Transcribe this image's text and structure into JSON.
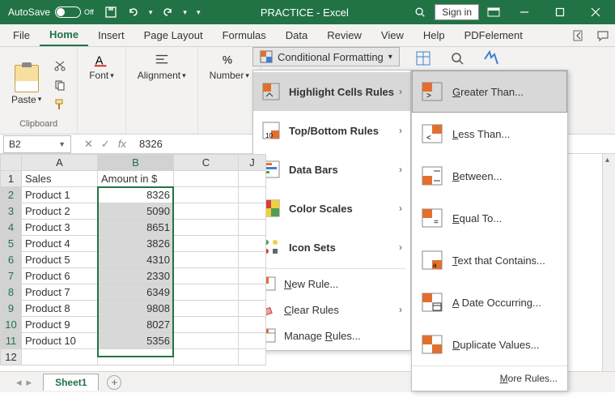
{
  "title_bar": {
    "autosave": "AutoSave",
    "autosave_state": "Off",
    "doc_title": "PRACTICE  -  Excel",
    "signin": "Sign in"
  },
  "tabs": {
    "items": [
      "File",
      "Home",
      "Insert",
      "Page Layout",
      "Formulas",
      "Data",
      "Review",
      "View",
      "Help",
      "PDFelement"
    ],
    "active_index": 1
  },
  "ribbon": {
    "clipboard_label": "Clipboard",
    "paste": "Paste",
    "font": "Font",
    "alignment": "Alignment",
    "number": "Number",
    "cf_button": "Conditional Formatting",
    "menu": {
      "highlight": "Highlight Cells Rules",
      "topbottom": "Top/Bottom Rules",
      "databars": "Data Bars",
      "colorscales": "Color Scales",
      "iconsets": "Icon Sets",
      "newrule": "New Rule...",
      "clearrules": "Clear Rules",
      "managerules": "Manage Rules..."
    },
    "submenu": {
      "greater": "Greater Than...",
      "less": "Less Than...",
      "between": "Between...",
      "equal": "Equal To...",
      "textcontains": "Text that Contains...",
      "dateoccur": "A Date Occurring...",
      "duplicate": "Duplicate Values...",
      "more": "More Rules..."
    }
  },
  "formula_bar": {
    "name": "B2",
    "value": "8326"
  },
  "grid": {
    "headers": [
      "A",
      "B",
      "C",
      "J"
    ],
    "row_labels": [
      "1",
      "2",
      "3",
      "4",
      "5",
      "6",
      "7",
      "8",
      "9",
      "10",
      "11",
      "12"
    ],
    "a_header": "Sales",
    "b_header": "Amount in $",
    "rows": [
      {
        "a": "Product 1",
        "b": "8326"
      },
      {
        "a": "Product 2",
        "b": "5090"
      },
      {
        "a": "Product 3",
        "b": "8651"
      },
      {
        "a": "Product 4",
        "b": "3826"
      },
      {
        "a": "Product 5",
        "b": "4310"
      },
      {
        "a": "Product 6",
        "b": "2330"
      },
      {
        "a": "Product 7",
        "b": "6349"
      },
      {
        "a": "Product 8",
        "b": "9808"
      },
      {
        "a": "Product 9",
        "b": "8027"
      },
      {
        "a": "Product 10",
        "b": "5356"
      }
    ]
  },
  "sheets": {
    "active": "Sheet1"
  },
  "colors": {
    "excel_green": "#217346"
  }
}
